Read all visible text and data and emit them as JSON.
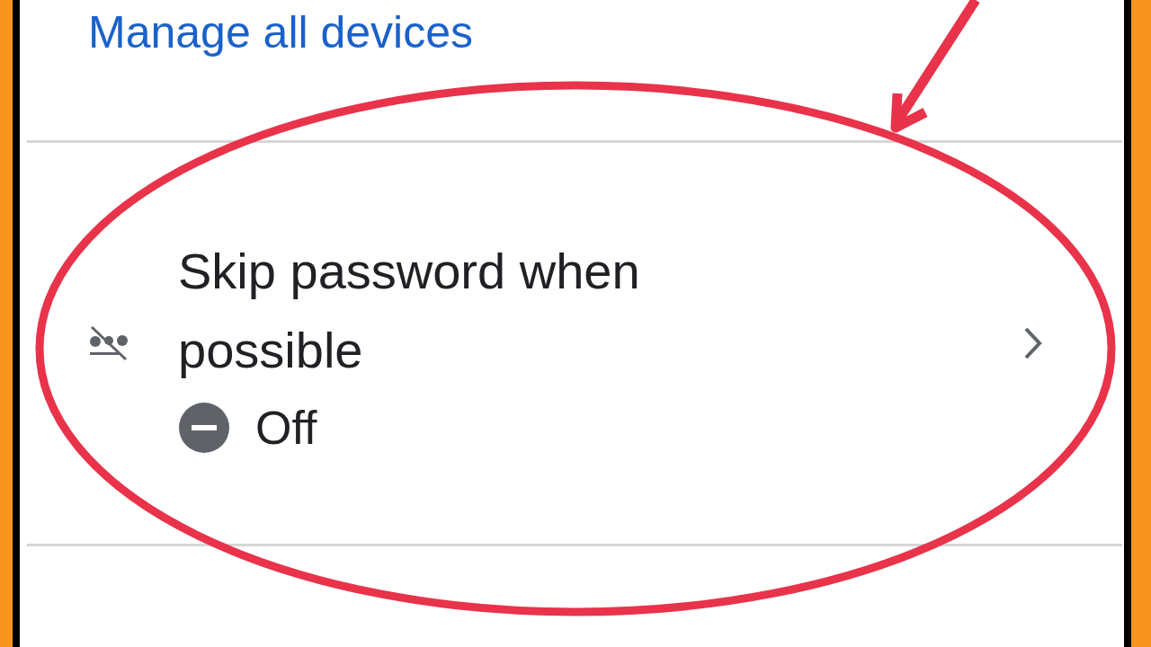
{
  "link": "Manage all devices",
  "setting": {
    "title": "Skip password when possible",
    "status": "Off",
    "on": false
  }
}
